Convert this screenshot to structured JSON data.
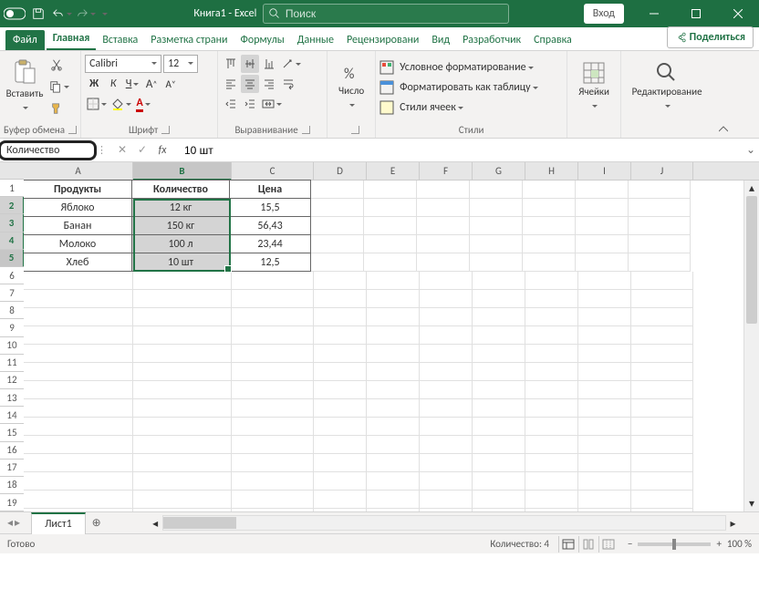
{
  "title": "Книга1 - Excel",
  "search_placeholder": "Поиск",
  "login": "Вход",
  "tabs": {
    "file": "Файл",
    "home": "Главная",
    "insert": "Вставка",
    "layout": "Разметка страни",
    "formulas": "Формулы",
    "data": "Данные",
    "review": "Рецензировани",
    "view": "Вид",
    "dev": "Разработчик",
    "help": "Справка"
  },
  "share": "Поделиться",
  "ribbon": {
    "clipboard": {
      "label": "Буфер обмена",
      "paste": "Вставить"
    },
    "font": {
      "label": "Шрифт",
      "name": "Calibri",
      "size": "12",
      "bold": "Ж",
      "italic": "К",
      "underline": "Ч"
    },
    "align": {
      "label": "Выравнивание"
    },
    "number": {
      "label": "Число",
      "btn": "%"
    },
    "styles": {
      "label": "Стили",
      "cond": "Условное форматирование",
      "table": "Форматировать как таблицу",
      "cell": "Стили ячеек"
    },
    "cells": {
      "label": "Ячейки"
    },
    "editing": {
      "label": "Редактирование"
    }
  },
  "name_box": "Количество",
  "formula": "10 шт",
  "cols": [
    "A",
    "B",
    "C",
    "D",
    "E",
    "F",
    "G",
    "H",
    "I",
    "J"
  ],
  "table": {
    "headers": {
      "a": "Продукты",
      "b": "Количество",
      "c": "Цена"
    },
    "rows": [
      {
        "a": "Яблоко",
        "b": "12 кг",
        "c": "15,5"
      },
      {
        "a": "Банан",
        "b": "150 кг",
        "c": "56,43"
      },
      {
        "a": "Молоко",
        "b": "100 л",
        "c": "23,44"
      },
      {
        "a": "Хлеб",
        "b": "10 шт",
        "c": "12,5"
      }
    ]
  },
  "sheet": "Лист1",
  "status": {
    "ready": "Готово",
    "count": "Количество: 4",
    "zoom": "100 %"
  }
}
